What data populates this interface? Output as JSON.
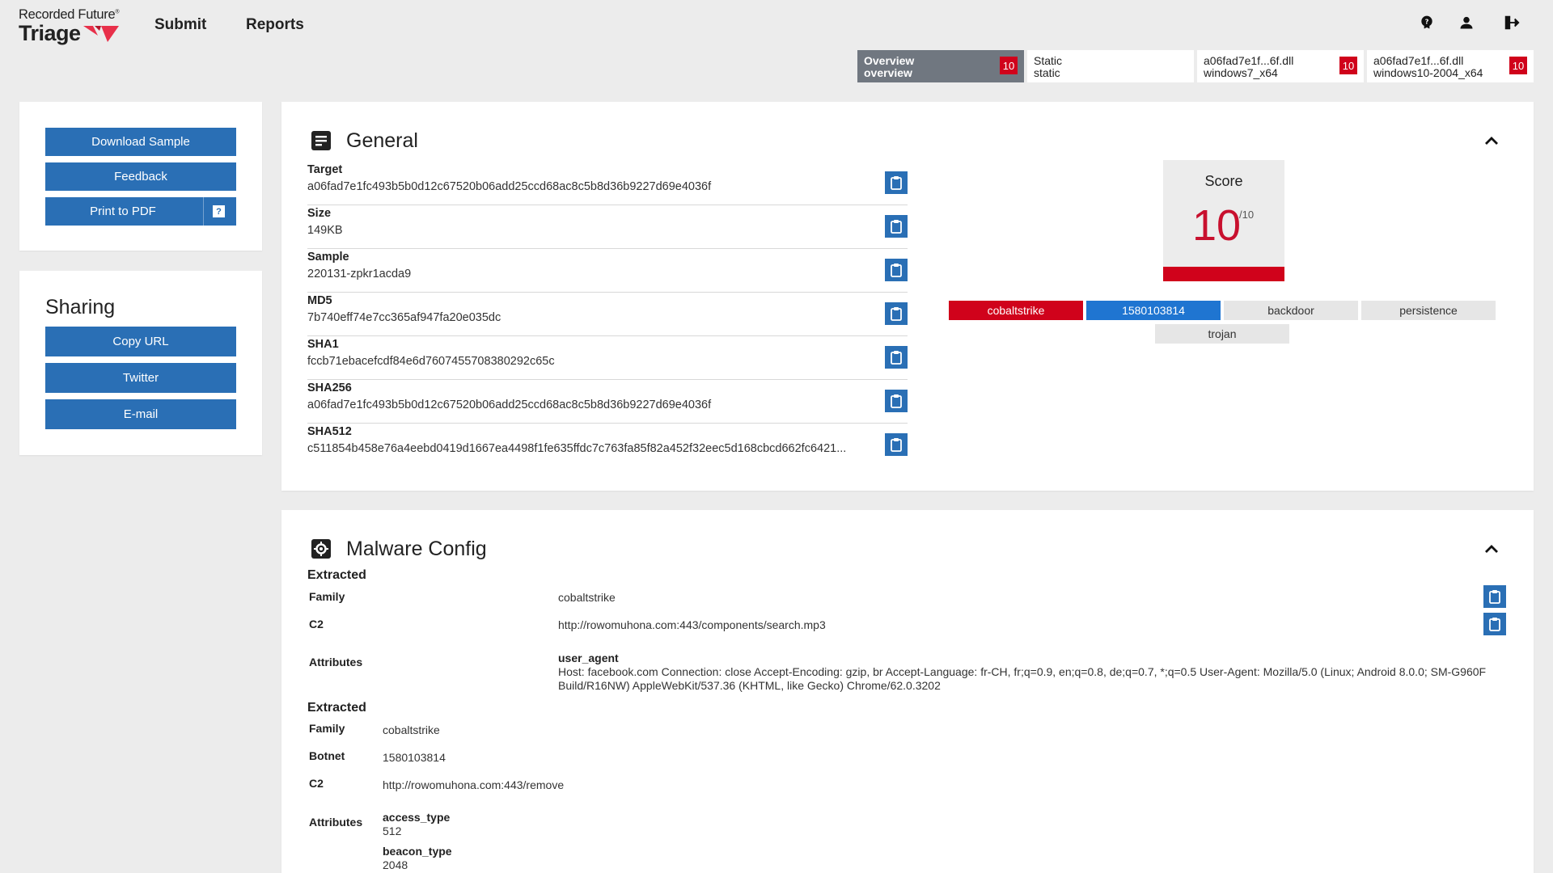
{
  "brand": {
    "company": "Recorded Future",
    "product": "Triage"
  },
  "nav": {
    "submit": "Submit",
    "reports": "Reports"
  },
  "header_icons": [
    "help-icon",
    "account-icon",
    "logout-icon"
  ],
  "tabs": [
    {
      "line1": "Overview",
      "line2": "overview",
      "score": "10",
      "active": true
    },
    {
      "line1": "Static",
      "line2": "static",
      "score": "",
      "active": false
    },
    {
      "line1": "a06fad7e1f...6f.dll",
      "line2": "windows7_x64",
      "score": "10",
      "active": false
    },
    {
      "line1": "a06fad7e1f...6f.dll",
      "line2": "windows10-2004_x64",
      "score": "10",
      "active": false
    }
  ],
  "actions": {
    "download": "Download Sample",
    "feedback": "Feedback",
    "print": "Print to PDF",
    "help": "?"
  },
  "sharing": {
    "title": "Sharing",
    "copy_url": "Copy URL",
    "twitter": "Twitter",
    "email": "E-mail"
  },
  "general": {
    "title": "General",
    "fields": [
      {
        "label": "Target",
        "value": "a06fad7e1fc493b5b0d12c67520b06add25ccd68ac8c5b8d36b9227d69e4036f"
      },
      {
        "label": "Size",
        "value": "149KB"
      },
      {
        "label": "Sample",
        "value": "220131-zpkr1acda9"
      },
      {
        "label": "MD5",
        "value": "7b740eff74e7cc365af947fa20e035dc"
      },
      {
        "label": "SHA1",
        "value": "fccb71ebacefcdf84e6d7607455708380292c65c"
      },
      {
        "label": "SHA256",
        "value": "a06fad7e1fc493b5b0d12c67520b06add25ccd68ac8c5b8d36b9227d69e4036f"
      },
      {
        "label": "SHA512",
        "value": "c511854b458e76a4eebd0419d1667ea4498f1fe635ffdc7c763fa85f82a452f32eec5d168cbcd662fc6421..."
      }
    ],
    "score": {
      "title": "Score",
      "value": "10",
      "max": "/10"
    },
    "tags": [
      {
        "text": "cobaltstrike",
        "style": "red"
      },
      {
        "text": "1580103814",
        "style": "blue"
      },
      {
        "text": "backdoor",
        "style": "grey"
      },
      {
        "text": "persistence",
        "style": "grey"
      },
      {
        "text": "trojan",
        "style": "grey"
      }
    ],
    "colors": {
      "accent": "#2a6fb5",
      "danger": "#d0021b",
      "family_tag": "#1f75d1"
    }
  },
  "malware": {
    "title": "Malware Config",
    "block1": {
      "heading": "Extracted",
      "family_label": "Family",
      "family": "cobaltstrike",
      "c2_label": "C2",
      "c2": "http://rowomuhona.com:443/components/search.mp3",
      "attrs_label": "Attributes",
      "ua_key": "user_agent",
      "ua_value": "Host: facebook.com Connection: close Accept-Encoding: gzip, br Accept-Language: fr-CH, fr;q=0.9, en;q=0.8, de;q=0.7, *;q=0.5 User-Agent: Mozilla/5.0 (Linux; Android 8.0.0; SM-G960F Build/R16NW) AppleWebKit/537.36 (KHTML, like Gecko) Chrome/62.0.3202"
    },
    "block2": {
      "heading": "Extracted",
      "family_label": "Family",
      "family": "cobaltstrike",
      "botnet_label": "Botnet",
      "botnet": "1580103814",
      "c2_label": "C2",
      "c2": "http://rowomuhona.com:443/remove",
      "attrs_label": "Attributes",
      "access_key": "access_type",
      "access_value": "512",
      "beacon_key": "beacon_type",
      "beacon_value": "2048"
    }
  }
}
